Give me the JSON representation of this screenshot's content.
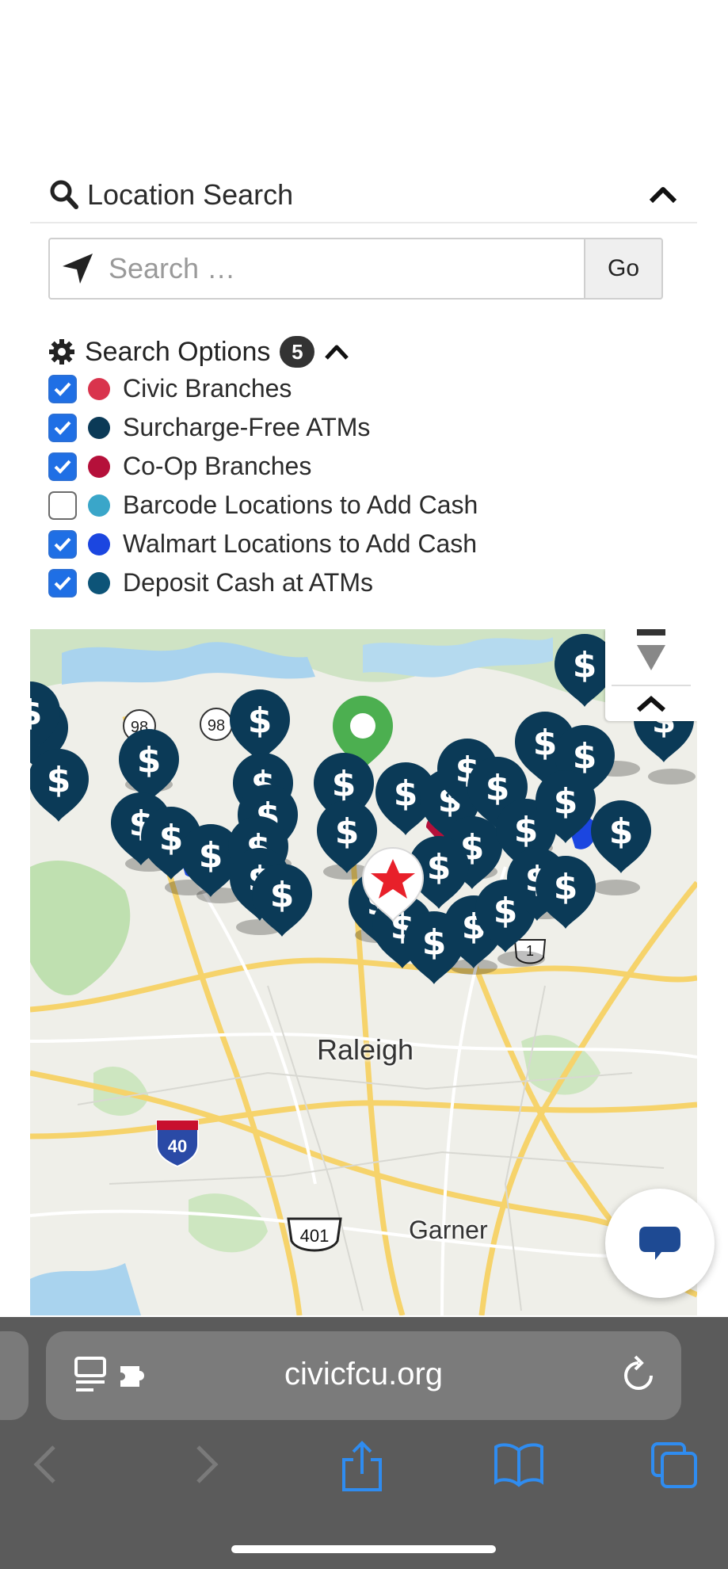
{
  "location_search": {
    "title": "Location Search",
    "search_placeholder": "Search …",
    "go_label": "Go"
  },
  "search_options": {
    "title": "Search Options",
    "count": "5",
    "items": [
      {
        "label": "Civic Branches",
        "checked": true,
        "color": "#d9344d"
      },
      {
        "label": "Surcharge-Free ATMs",
        "checked": true,
        "color": "#0b3a57"
      },
      {
        "label": "Co-Op Branches",
        "checked": true,
        "color": "#b5103a"
      },
      {
        "label": "Barcode Locations to Add Cash",
        "checked": false,
        "color": "#3aa6c9"
      },
      {
        "label": "Walmart Locations to Add Cash",
        "checked": true,
        "color": "#1b46e0"
      },
      {
        "label": "Deposit Cash at ATMs",
        "checked": true,
        "color": "#0d5478"
      }
    ]
  },
  "map": {
    "places": [
      "Raleigh",
      "Garner"
    ],
    "highways": [
      "98",
      "98",
      "40",
      "401",
      "1"
    ],
    "marker_symbol": "$",
    "colors": {
      "atm_pin": "#0b3a57",
      "current_location_pin": "#ffffff",
      "current_location_star": "#e8202a",
      "green_pin": "#4caf50",
      "coop_pin": "#b5103a",
      "walmart_pin": "#1b46e0"
    }
  },
  "browser": {
    "url": "civicfcu.org"
  }
}
